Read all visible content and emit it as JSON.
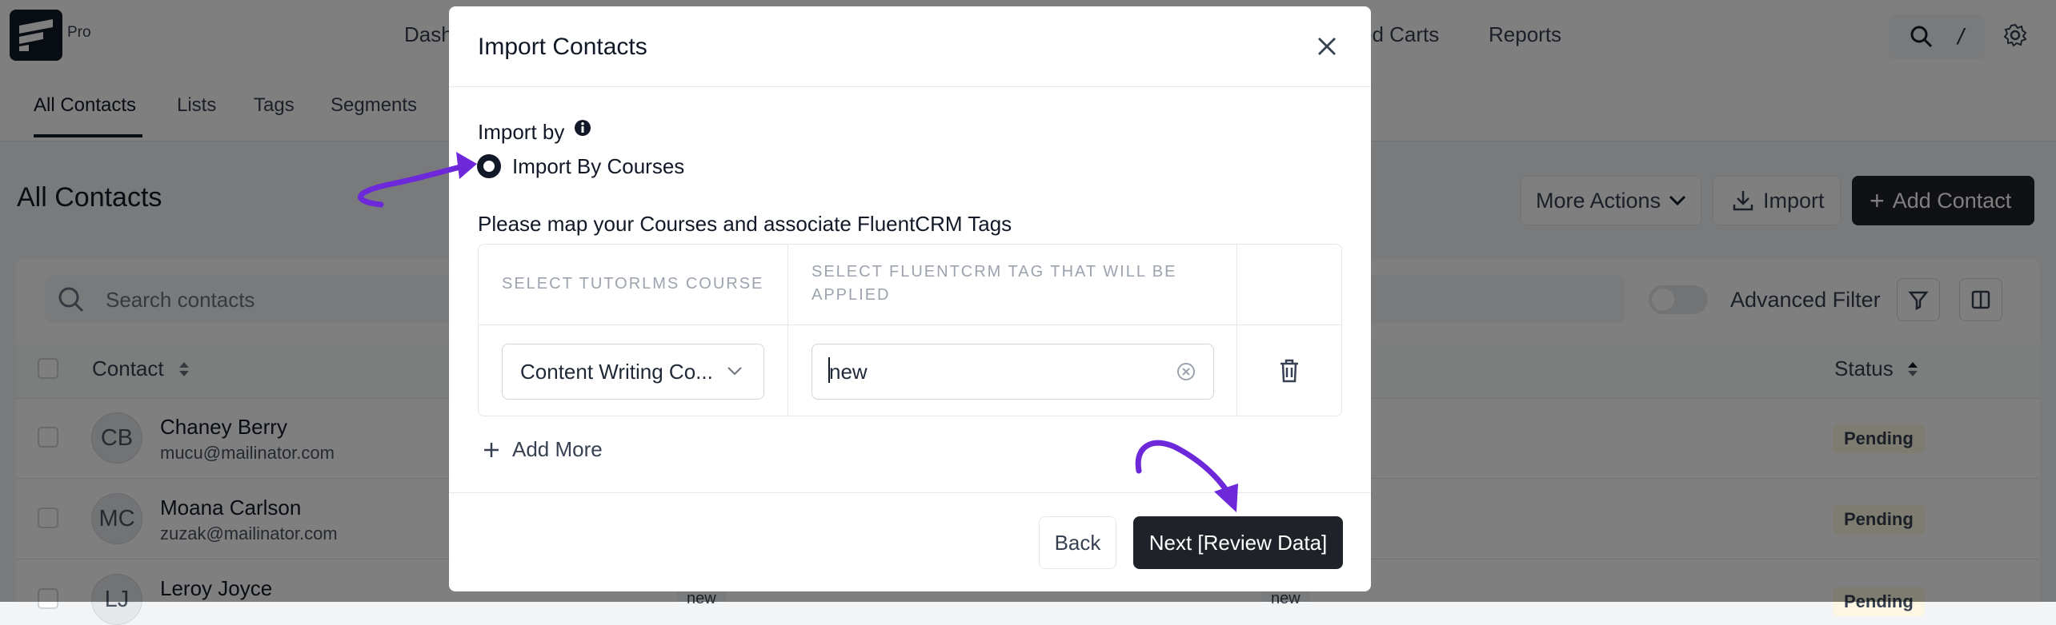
{
  "app": {
    "pro_label": "Pro",
    "nav": [
      {
        "label": "Dash"
      },
      {
        "label": "ed Carts"
      },
      {
        "label": "Reports"
      }
    ]
  },
  "subnav": {
    "tabs": [
      {
        "label": "All Contacts",
        "active": true
      },
      {
        "label": "Lists"
      },
      {
        "label": "Tags"
      },
      {
        "label": "Segments"
      }
    ]
  },
  "page": {
    "title": "All Contacts",
    "more_actions_label": "More Actions",
    "import_label": "Import",
    "add_contact_label": "Add Contact",
    "search_placeholder": "Search contacts",
    "advanced_filter_label": "Advanced Filter",
    "columns": {
      "contact": "Contact",
      "status": "Status"
    },
    "contacts": [
      {
        "initials": "CB",
        "name": "Chaney Berry",
        "email": "mucu@mailinator.com",
        "status": "Pending"
      },
      {
        "initials": "MC",
        "name": "Moana Carlson",
        "email": "zuzak@mailinator.com",
        "status": "Pending"
      },
      {
        "initials": "LJ",
        "name": "Leroy Joyce",
        "email": "",
        "status": "Pending",
        "tags": [
          "new",
          "new"
        ]
      }
    ]
  },
  "modal": {
    "title": "Import Contacts",
    "import_by_label": "Import by",
    "option_label": "Import By Courses",
    "map_title": "Please map your Courses and associate FluentCRM Tags",
    "col_course": "SELECT TUTORLMS COURSE",
    "col_tag_line1": "SELECT FLUENTCRM TAG THAT WILL BE",
    "col_tag_line2": "APPLIED",
    "row": {
      "course": "Content Writing Co...",
      "tag": "new"
    },
    "add_more_label": "Add More",
    "back_label": "Back",
    "next_label": "Next [Review Data]"
  },
  "colors": {
    "dark": "#1f2329",
    "annotation_arrow": "#6d28d9",
    "badge_bg": "#fdf6e3"
  }
}
